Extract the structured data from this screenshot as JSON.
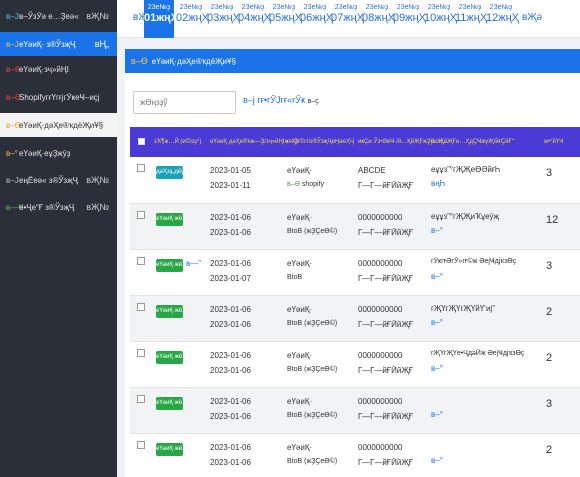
{
  "sidebar": {
    "items": [
      {
        "label": "в–ЎзӮә е…Ҙеә«",
        "icon": "inbound-icon",
        "chev": "вҖ№"
      },
      {
        "label": "еҮәиҚ· з®ЎзҗҶ",
        "icon": "outbound-icon",
        "chev": "вҢ„"
      },
      {
        "label": "еҮәиҚ·зҷ»йҢІ",
        "icon": "register-icon"
      },
      {
        "label": "ShopifyгғҮгғјгӮҝеҸ–иҫј",
        "icon": "shopify-icon"
      },
      {
        "label": "еҮәиҚ·дәҲе®ҡдёҖиҰ§",
        "icon": "list-icon"
      },
      {
        "label": "еҮәиҚ·еұҘжӯҙ",
        "icon": "history-icon"
      },
      {
        "label": "еңЁеә« з®ЎзҗҶ",
        "icon": "stock-icon",
        "chev": "вҖ№"
      },
      {
        "label": "е•Ҷе“Ғ з®ЎзҗҶ",
        "icon": "product-icon",
        "chev": "вҖ№"
      }
    ]
  },
  "months": {
    "prev": "вҖ№",
    "next": "вҖә",
    "items": [
      {
        "yr": "23е№ҙ",
        "mn": "01жңҲ"
      },
      {
        "yr": "23е№ҙ",
        "mn": "02жңҲ"
      },
      {
        "yr": "23е№ҙ",
        "mn": "03жңҲ"
      },
      {
        "yr": "23е№ҙ",
        "mn": "04жңҲ"
      },
      {
        "yr": "23е№ҙ",
        "mn": "05жңҲ"
      },
      {
        "yr": "23е№ҙ",
        "mn": "06жңҲ"
      },
      {
        "yr": "23е№ҙ",
        "mn": "07жңҲ"
      },
      {
        "yr": "23е№ҙ",
        "mn": "08жңҲ"
      },
      {
        "yr": "23е№ҙ",
        "mn": "09жңҲ"
      },
      {
        "yr": "23е№ҙ",
        "mn": "10жңҲ"
      },
      {
        "yr": "23е№ҙ",
        "mn": "11жңҲ"
      },
      {
        "yr": "23е№ҙ",
        "mn": "12жңҲ"
      }
    ]
  },
  "panel": {
    "title": "еҮәиҚ·дәҲе®ҡдёҖиҰ§"
  },
  "search": {
    "placeholder": "жӨңзҙў"
  },
  "filter": {
    "label": "гғ•гӮЈгғ«гӮҝ",
    "caret": "в–ҫ"
  },
  "table": {
    "headers": [
      "зҠ¶ж…Ӣ (и©ізҙ°)",
      "еҮәиҚ·дәҲе®ҡж—Ҙ/зҷ»йҢІж—Ҙ",
      "гғҲгғ©гғіз®ЎзҗҶеҢәеҲҶ",
      "иҝҪи·Ўз•ӘеҸ·/й…ҚйҖҒжҘӯиҖ…",
      "й…ҚйҖҒе…ҲдҪҸжүҖ/йғҪйҒ“",
      "ж•°йҮҸ"
    ],
    "rows": [
      {
        "status": "дәҲзҙ„дёӯ",
        "badge": "teal",
        "d1": "2023-01-05",
        "d2": "2023-01-11",
        "t1": "еҮәиҚ·",
        "t2": "shopify",
        "track": "ABCDE",
        "carrier": "Г—Г—йҒӢйҖҒ",
        "dest": "еұұз”°гҖҖеӨӘйғҺ",
        "icon": "pencil-icon",
        "qty": "3",
        "chat": false
      },
      {
        "status": "еҮәиҚ·жёҲ",
        "badge": "green",
        "d1": "2023-01-06",
        "d2": "2023-01-06",
        "t1": "еҮәиҚ·",
        "t2": "BtoB (жҘҪеӨ©)",
        "track": "0000000000",
        "carrier": "Г—Г—йҒӢйҖҒ",
        "dest": "еұұз”°гҖҖиҠұеӯҗ",
        "icon": "truck-icon",
        "qty": "12",
        "chat": false
      },
      {
        "status": "еҮәиҚ·жёҲ",
        "badge": "green",
        "d1": "2023-01-06",
        "d2": "2023-01-07",
        "t1": "еҮәиҚ·",
        "t2": "BtoB",
        "track": "0000000000",
        "carrier": "Г—Г—йҒӢйҖҒ",
        "dest": "гӮҝгғӘгӮ»гғ©ж ӘејҸдјҡзӨҫ",
        "icon": "truck-icon",
        "qty": "3",
        "chat": true
      },
      {
        "status": "еҮәиҚ·жёҲ",
        "badge": "green",
        "d1": "2023-01-06",
        "d2": "2023-01-06",
        "t1": "еҮәиҚ·",
        "t2": "BtoB (жҘҪеӨ©)",
        "track": "0000000000",
        "carrier": "Г—Г—йҒӢйҖҒ",
        "dest": "гҖҮгҖҮгҖҮйҮ‘иј”",
        "icon": "truck-icon",
        "qty": "2",
        "chat": false
      },
      {
        "status": "еҮәиҚ·жёҲ",
        "badge": "green",
        "d1": "2023-01-06",
        "d2": "2023-01-06",
        "t1": "еҮәиҚ·",
        "t2": "BtoB (жҘҪеӨ©)",
        "track": "0000000000",
        "carrier": "Г—Г—йҒӢйҖҒ",
        "dest": "гҖҮгҖҮе•ҶдәӢж ӘејҸдјҡзӨҫ",
        "icon": "truck-icon",
        "qty": "2",
        "chat": false
      },
      {
        "status": "еҮәиҚ·жёҲ",
        "badge": "green",
        "d1": "2023-01-06",
        "d2": "2023-01-06",
        "t1": "еҮәиҚ·",
        "t2": "BtoB (жҘҪеӨ©)",
        "track": "0000000000",
        "carrier": "Г—Г—йҒӢйҖҒ",
        "dest": "",
        "icon": "truck-icon",
        "qty": "3",
        "chat": false
      },
      {
        "status": "еҮәиҚ·жёҲ",
        "badge": "green",
        "d1": "2023-01-06",
        "d2": "2023-01-06",
        "t1": "еҮәиҚ·",
        "t2": "BtoB (жҘҪеӨ©)",
        "track": "0000000000",
        "carrier": "Г—Г—йҒӢйҖҒ",
        "dest": "",
        "icon": "truck-icon",
        "qty": "2",
        "chat": false
      }
    ]
  },
  "colors": {
    "accent": "#1a73e8",
    "sidebar": "#2b2f3a",
    "header": "#4a3ad6",
    "header_text": "#f5d547",
    "badge_green": "#27a745",
    "badge_teal": "#19a1b8"
  }
}
